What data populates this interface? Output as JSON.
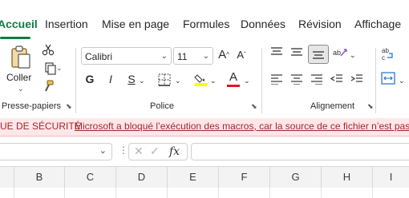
{
  "ribbon_tabs": [
    {
      "label": "Accueil",
      "active": true
    },
    {
      "label": "Insertion"
    },
    {
      "label": "Mise en page"
    },
    {
      "label": "Formules"
    },
    {
      "label": "Données"
    },
    {
      "label": "Révision"
    },
    {
      "label": "Affichage"
    }
  ],
  "clipboard": {
    "paste_label": "Coller",
    "group_label": "Presse-papiers"
  },
  "font": {
    "name": "Calibri",
    "size": "11",
    "bold_label": "G",
    "italic_label": "I",
    "underline_label": "S",
    "grow_label": "A",
    "shrink_label": "A",
    "color_label": "A",
    "group_label": "Police"
  },
  "alignment": {
    "group_label": "Alignement"
  },
  "security_bar": {
    "title": "UE DE SÉCURITÉ",
    "message": "Microsoft a bloqué l’exécution des macros, car la source de ce fichier n’est pas a"
  },
  "formula_bar": {
    "fx_label": "fx",
    "cancel_label": "✕",
    "enter_label": "✓"
  },
  "grid": {
    "columns": [
      "B",
      "C",
      "D",
      "E",
      "F",
      "G",
      "H",
      "I"
    ]
  },
  "colors": {
    "accent": "#107c41",
    "security_text": "#a4262c",
    "security_bg": "#fde7e9",
    "font_color": "#e81123",
    "highlight": "#ffff00"
  }
}
